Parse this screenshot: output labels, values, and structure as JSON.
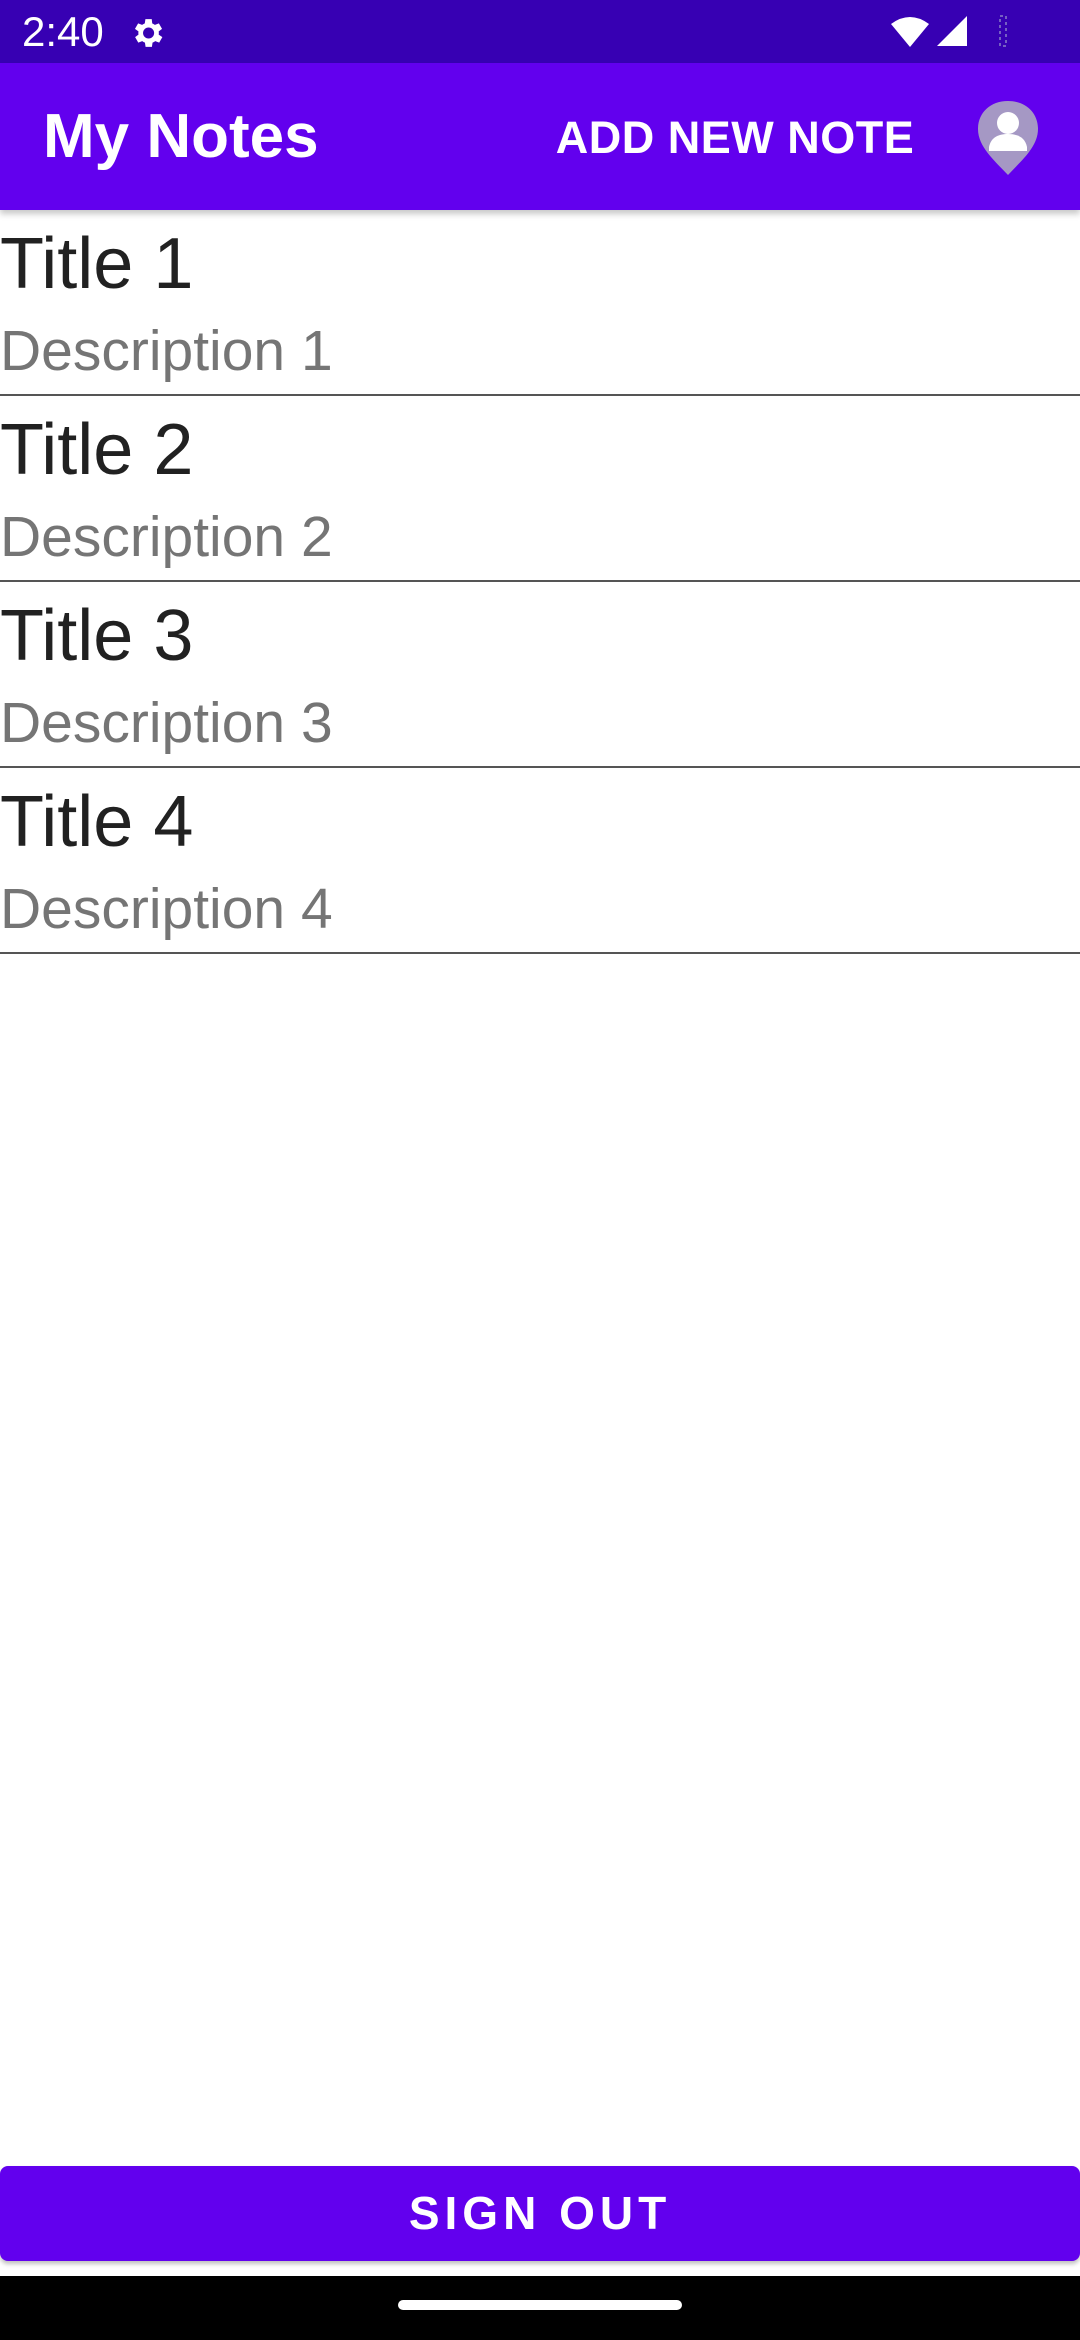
{
  "status_bar": {
    "time": "2:40",
    "icons": [
      "gear-icon",
      "wifi-icon",
      "signal-icon",
      "battery-icon"
    ]
  },
  "app_bar": {
    "title": "My Notes",
    "add_note_label": "ADD NEW NOTE",
    "profile_icon": "profile-icon"
  },
  "notes": [
    {
      "title": "Title 1",
      "description": "Description 1"
    },
    {
      "title": "Title 2",
      "description": "Description 2"
    },
    {
      "title": "Title 3",
      "description": "Description 3"
    },
    {
      "title": "Title 4",
      "description": "Description 4"
    }
  ],
  "sign_out_label": "SIGN OUT",
  "colors": {
    "status_bar": "#3700b3",
    "primary": "#6200ee",
    "title_text": "#212121",
    "description_text": "#757575"
  }
}
